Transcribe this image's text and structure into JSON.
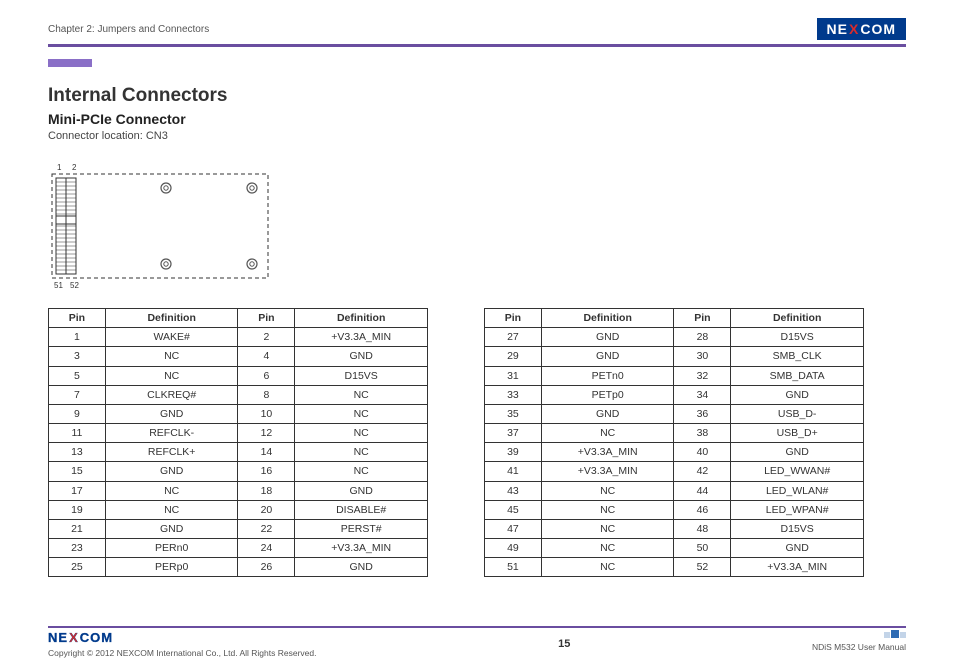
{
  "header": {
    "chapter": "Chapter 2: Jumpers and Connectors",
    "brand_left": "NE",
    "brand_x": "X",
    "brand_right": "COM"
  },
  "title": "Internal Connectors",
  "subtitle": "Mini-PCIe Connector",
  "conn_location": "Connector location: CN3",
  "diagram_labels": {
    "tl": "1",
    "tr": "2",
    "bl": "51",
    "br": "52"
  },
  "col_headers": {
    "pin": "Pin",
    "def": "Definition"
  },
  "table_left": [
    {
      "p1": "1",
      "d1": "WAKE#",
      "p2": "2",
      "d2": "+V3.3A_MIN"
    },
    {
      "p1": "3",
      "d1": "NC",
      "p2": "4",
      "d2": "GND"
    },
    {
      "p1": "5",
      "d1": "NC",
      "p2": "6",
      "d2": "D15VS"
    },
    {
      "p1": "7",
      "d1": "CLKREQ#",
      "p2": "8",
      "d2": "NC"
    },
    {
      "p1": "9",
      "d1": "GND",
      "p2": "10",
      "d2": "NC"
    },
    {
      "p1": "11",
      "d1": "REFCLK-",
      "p2": "12",
      "d2": "NC"
    },
    {
      "p1": "13",
      "d1": "REFCLK+",
      "p2": "14",
      "d2": "NC"
    },
    {
      "p1": "15",
      "d1": "GND",
      "p2": "16",
      "d2": "NC"
    },
    {
      "p1": "17",
      "d1": "NC",
      "p2": "18",
      "d2": "GND"
    },
    {
      "p1": "19",
      "d1": "NC",
      "p2": "20",
      "d2": "DISABLE#"
    },
    {
      "p1": "21",
      "d1": "GND",
      "p2": "22",
      "d2": "PERST#"
    },
    {
      "p1": "23",
      "d1": "PERn0",
      "p2": "24",
      "d2": "+V3.3A_MIN"
    },
    {
      "p1": "25",
      "d1": "PERp0",
      "p2": "26",
      "d2": "GND"
    }
  ],
  "table_right": [
    {
      "p1": "27",
      "d1": "GND",
      "p2": "28",
      "d2": "D15VS"
    },
    {
      "p1": "29",
      "d1": "GND",
      "p2": "30",
      "d2": "SMB_CLK"
    },
    {
      "p1": "31",
      "d1": "PETn0",
      "p2": "32",
      "d2": "SMB_DATA"
    },
    {
      "p1": "33",
      "d1": "PETp0",
      "p2": "34",
      "d2": "GND"
    },
    {
      "p1": "35",
      "d1": "GND",
      "p2": "36",
      "d2": "USB_D-"
    },
    {
      "p1": "37",
      "d1": "NC",
      "p2": "38",
      "d2": "USB_D+"
    },
    {
      "p1": "39",
      "d1": "+V3.3A_MIN",
      "p2": "40",
      "d2": "GND"
    },
    {
      "p1": "41",
      "d1": "+V3.3A_MIN",
      "p2": "42",
      "d2": "LED_WWAN#"
    },
    {
      "p1": "43",
      "d1": "NC",
      "p2": "44",
      "d2": "LED_WLAN#"
    },
    {
      "p1": "45",
      "d1": "NC",
      "p2": "46",
      "d2": "LED_WPAN#"
    },
    {
      "p1": "47",
      "d1": "NC",
      "p2": "48",
      "d2": "D15VS"
    },
    {
      "p1": "49",
      "d1": "NC",
      "p2": "50",
      "d2": "GND"
    },
    {
      "p1": "51",
      "d1": "NC",
      "p2": "52",
      "d2": "+V3.3A_MIN"
    }
  ],
  "footer": {
    "copyright": "Copyright © 2012 NEXCOM International Co., Ltd. All Rights Reserved.",
    "page": "15",
    "manual": "NDiS M532 User Manual"
  }
}
